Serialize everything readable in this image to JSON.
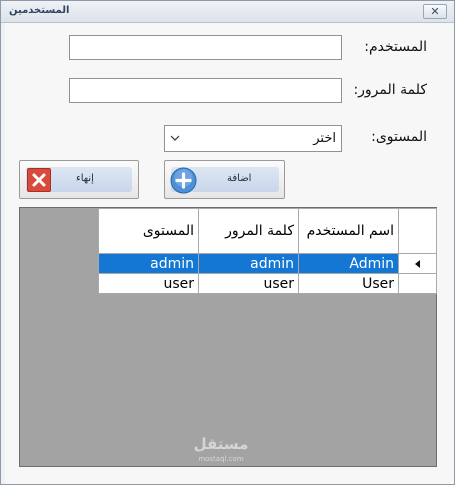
{
  "window": {
    "title": "المستخدمين",
    "close_glyph": "✕"
  },
  "form": {
    "username_label": "المستخدم:",
    "username_value": "",
    "password_label": "كلمة المرور:",
    "password_value": "",
    "level_label": "المستوى:",
    "level_selected": "اختر",
    "chevron_icon": "chevron-down-icon"
  },
  "buttons": {
    "finish_label": "إنهاء",
    "finish_icon": "close-x-icon",
    "add_label": "اضافة",
    "add_icon": "plus-circle-icon"
  },
  "grid": {
    "columns": [
      "اسم المستخدم",
      "كلمة المرور",
      "المستوى"
    ],
    "rows": [
      {
        "username": "Admin",
        "password": "admin",
        "level": "admin",
        "selected": true
      },
      {
        "username": "User",
        "password": "user",
        "level": "user",
        "selected": false
      }
    ],
    "selection_color": "#1477d4"
  },
  "watermark": {
    "text": "مستقل",
    "sub": "mostaql.com"
  }
}
